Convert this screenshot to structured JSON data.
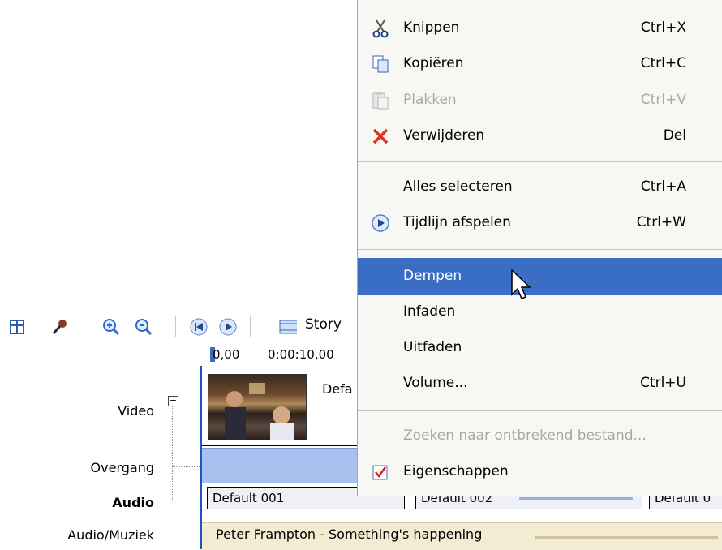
{
  "toolbar": {
    "icons": [
      "storyboard-icon",
      "narrate-icon",
      "zoom-in-icon",
      "zoom-out-icon",
      "rewind-icon",
      "play-icon",
      "storyboard-view-icon"
    ],
    "story_label": "Story"
  },
  "ruler": {
    "t0": "0,00",
    "t1": "0:00:10,00"
  },
  "tracks": {
    "video": "Video",
    "transition": "Overgang",
    "audio": "Audio",
    "music": "Audio/Muziek"
  },
  "timeline": {
    "video_clip_title": "Defa",
    "audio_clips": [
      "Default 001",
      "Default 002",
      "Default 0"
    ],
    "music_clip": "Peter Frampton - Something's happening"
  },
  "menu": {
    "items": [
      {
        "label": "Knippen",
        "shortcut": "Ctrl+X",
        "icon": "scissors-icon",
        "enabled": true
      },
      {
        "label": "Kopiëren",
        "shortcut": "Ctrl+C",
        "icon": "copy-icon",
        "enabled": true
      },
      {
        "label": "Plakken",
        "shortcut": "Ctrl+V",
        "icon": "paste-icon",
        "enabled": false
      },
      {
        "label": "Verwijderen",
        "shortcut": "Del",
        "icon": "delete-icon",
        "enabled": true
      },
      {
        "label": "Alles selecteren",
        "shortcut": "Ctrl+A",
        "icon": "",
        "enabled": true
      },
      {
        "label": "Tijdlijn afspelen",
        "shortcut": "Ctrl+W",
        "icon": "play-icon",
        "enabled": true
      },
      {
        "label": "Dempen",
        "shortcut": "",
        "icon": "",
        "enabled": true,
        "highlighted": true
      },
      {
        "label": "Infaden",
        "shortcut": "",
        "icon": "",
        "enabled": true
      },
      {
        "label": "Uitfaden",
        "shortcut": "",
        "icon": "",
        "enabled": true
      },
      {
        "label": "Volume...",
        "shortcut": "Ctrl+U",
        "icon": "",
        "enabled": true
      },
      {
        "label": "Zoeken naar ontbrekend bestand...",
        "shortcut": "",
        "icon": "",
        "enabled": false
      },
      {
        "label": "Eigenschappen",
        "shortcut": "",
        "icon": "properties-icon",
        "enabled": true
      }
    ],
    "highlight_color": "#3a6ec5"
  }
}
